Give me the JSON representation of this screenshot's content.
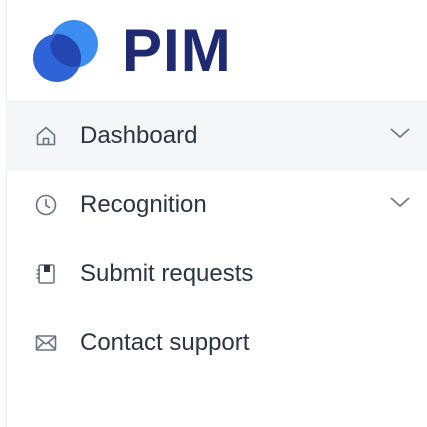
{
  "brand": {
    "name": "PIM",
    "logo_icon": "overlapping-circles-logo",
    "colors": {
      "text": "#1f2a72",
      "circle_front": "#1f4fc9",
      "circle_back": "#3b8df0"
    }
  },
  "nav": {
    "items": [
      {
        "label": "Dashboard",
        "icon": "home-icon",
        "expandable": true,
        "active": true
      },
      {
        "label": "Recognition",
        "icon": "clock-icon",
        "expandable": true,
        "active": false
      },
      {
        "label": "Submit requests",
        "icon": "document-icon",
        "expandable": false,
        "active": false
      },
      {
        "label": "Contact support",
        "icon": "envelope-icon",
        "expandable": false,
        "active": false
      }
    ]
  },
  "colors": {
    "text": "#2b3445",
    "icon": "#6b7383",
    "active_bg": "#f5f6f8"
  }
}
